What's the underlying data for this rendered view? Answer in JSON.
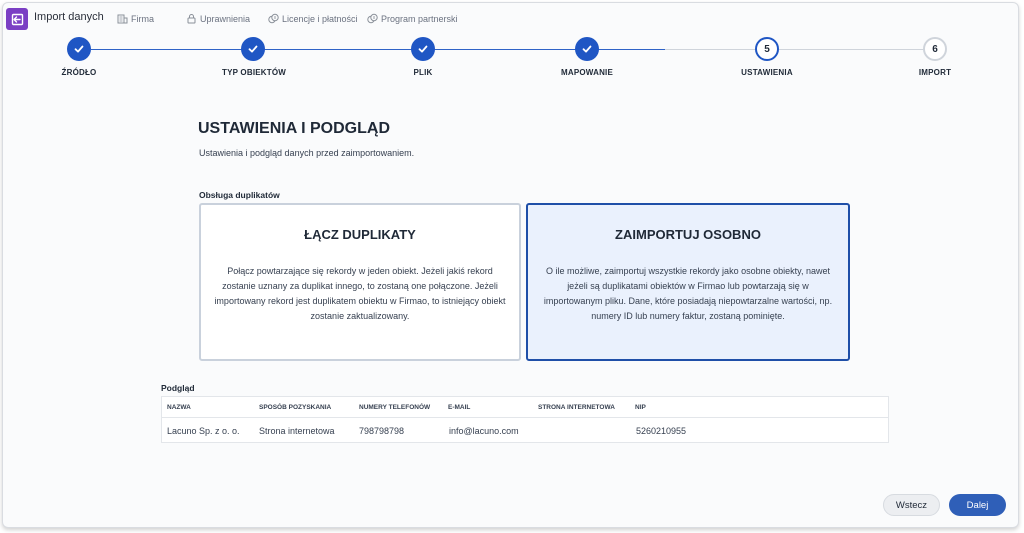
{
  "app": {
    "title": "Import danych"
  },
  "nav": [
    {
      "label": "Firma",
      "icon": "building-icon"
    },
    {
      "label": "Uprawnienia",
      "icon": "lock-icon"
    },
    {
      "label": "Licencje i płatności",
      "icon": "coins-icon"
    },
    {
      "label": "Program partnerski",
      "icon": "coins-icon"
    }
  ],
  "steps": [
    {
      "label": "ŹRÓDŁO",
      "state": "done",
      "number": ""
    },
    {
      "label": "TYP OBIEKTÓW",
      "state": "done",
      "number": ""
    },
    {
      "label": "PLIK",
      "state": "done",
      "number": ""
    },
    {
      "label": "MAPOWANIE",
      "state": "done",
      "number": ""
    },
    {
      "label": "USTAWIENIA",
      "state": "current",
      "number": "5"
    },
    {
      "label": "IMPORT",
      "state": "todo",
      "number": "6"
    }
  ],
  "page": {
    "title": "USTAWIENIA I PODGLĄD",
    "subtitle": "Ustawienia i podgląd danych przed zaimportowaniem."
  },
  "duplicates": {
    "label": "Obsługa duplikatów",
    "options": [
      {
        "title": "ŁĄCZ DUPLIKATY",
        "description": "Połącz powtarzające się rekordy w jeden obiekt. Jeżeli jakiś rekord zostanie uznany za duplikat innego, to zostaną one połączone. Jeżeli importowany rekord jest duplikatem obiektu w Firmao, to istniejący obiekt zostanie zaktualizowany.",
        "selected": false
      },
      {
        "title": "ZAIMPORTUJ OSOBNO",
        "description": "O ile możliwe, zaimportuj wszystkie rekordy jako osobne obiekty, nawet jeżeli są duplikatami obiektów w Firmao lub powtarzają się w importowanym pliku. Dane, które posiadają niepowtarzalne wartości, np. numery ID lub numery faktur, zostaną pominięte.",
        "selected": true
      }
    ]
  },
  "preview": {
    "label": "Podgląd",
    "columns": [
      "NAZWA",
      "SPOSÓB POZYSKANIA",
      "NUMERY TELEFONÓW",
      "E-MAIL",
      "STRONA INTERNETOWA",
      "NIP"
    ],
    "rows": [
      [
        "Lacuno Sp. z o. o.",
        "Strona internetowa",
        "798798798",
        "info@lacuno.com",
        "",
        "5260210955"
      ]
    ]
  },
  "footer": {
    "back_label": "Wstecz",
    "next_label": "Dalej"
  },
  "colors": {
    "accent": "#1f56c4",
    "brand": "#7b3fc4",
    "selected_bg": "#eaf1fd",
    "primary_button": "#2f5fb8"
  }
}
